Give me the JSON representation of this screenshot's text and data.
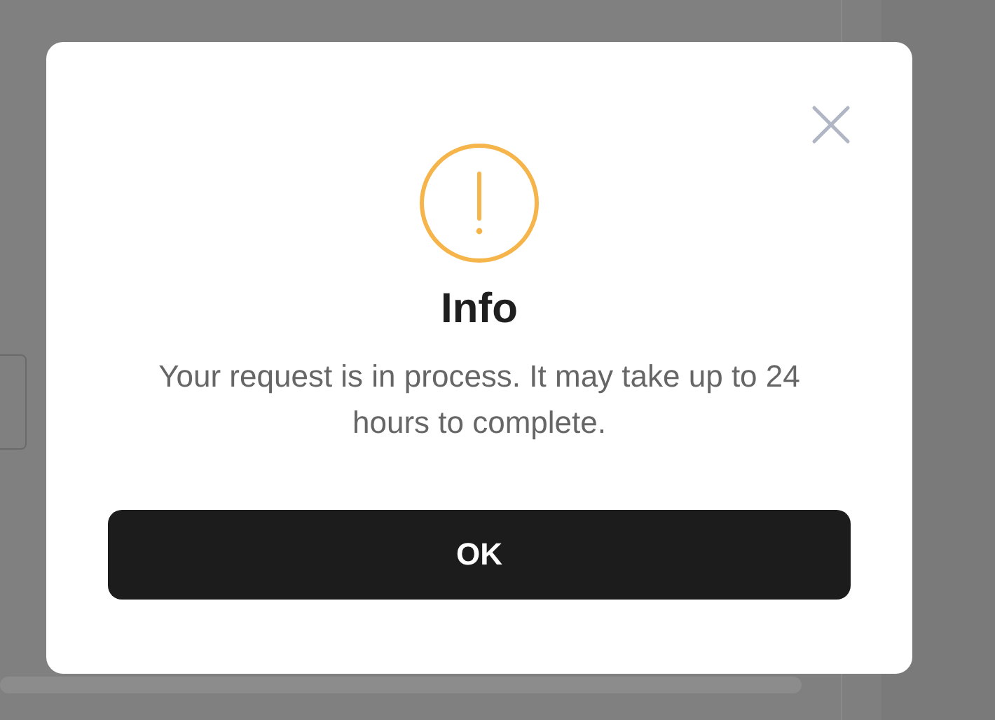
{
  "dialog": {
    "title": "Info",
    "message": "Your request is in process. It may take up to 24 hours to complete.",
    "buttons": [
      "OK"
    ]
  }
}
